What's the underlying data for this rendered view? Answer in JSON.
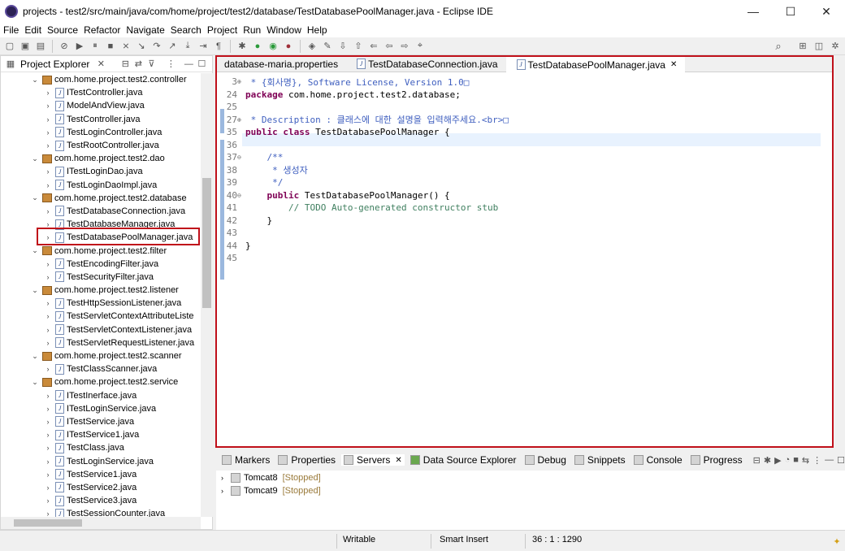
{
  "window": {
    "title": "projects - test2/src/main/java/com/home/project/test2/database/TestDatabasePoolManager.java - Eclipse IDE",
    "min": "—",
    "max": "☐",
    "close": "✕"
  },
  "menu": [
    "File",
    "Edit",
    "Source",
    "Refactor",
    "Navigate",
    "Search",
    "Project",
    "Run",
    "Window",
    "Help"
  ],
  "project_explorer": {
    "title": "Project Explorer",
    "tree": [
      {
        "kind": "pkg",
        "label": "com.home.project.test2.controller"
      },
      {
        "kind": "file",
        "label": "ITestController.java"
      },
      {
        "kind": "file",
        "label": "ModelAndView.java"
      },
      {
        "kind": "file",
        "label": "TestController.java"
      },
      {
        "kind": "file",
        "label": "TestLoginController.java"
      },
      {
        "kind": "file",
        "label": "TestRootController.java"
      },
      {
        "kind": "pkg",
        "label": "com.home.project.test2.dao"
      },
      {
        "kind": "file",
        "label": "ITestLoginDao.java"
      },
      {
        "kind": "file",
        "label": "TestLoginDaoImpl.java"
      },
      {
        "kind": "pkg",
        "label": "com.home.project.test2.database"
      },
      {
        "kind": "file",
        "label": "TestDatabaseConnection.java"
      },
      {
        "kind": "file",
        "label": "TestDatabaseManager.java"
      },
      {
        "kind": "file",
        "label": "TestDatabasePoolManager.java"
      },
      {
        "kind": "pkg",
        "label": "com.home.project.test2.filter"
      },
      {
        "kind": "file",
        "label": "TestEncodingFilter.java"
      },
      {
        "kind": "file",
        "label": "TestSecurityFilter.java"
      },
      {
        "kind": "pkg",
        "label": "com.home.project.test2.listener"
      },
      {
        "kind": "file",
        "label": "TestHttpSessionListener.java"
      },
      {
        "kind": "file",
        "label": "TestServletContextAttributeListe"
      },
      {
        "kind": "file",
        "label": "TestServletContextListener.java"
      },
      {
        "kind": "file",
        "label": "TestServletRequestListener.java"
      },
      {
        "kind": "pkg",
        "label": "com.home.project.test2.scanner"
      },
      {
        "kind": "file",
        "label": "TestClassScanner.java"
      },
      {
        "kind": "pkg",
        "label": "com.home.project.test2.service"
      },
      {
        "kind": "file",
        "label": "ITestInerface.java"
      },
      {
        "kind": "file",
        "label": "ITestLoginService.java"
      },
      {
        "kind": "file",
        "label": "ITestService.java"
      },
      {
        "kind": "file",
        "label": "ITestService1.java"
      },
      {
        "kind": "file",
        "label": "TestClass.java"
      },
      {
        "kind": "file",
        "label": "TestLoginService.java"
      },
      {
        "kind": "file",
        "label": "TestService1.java"
      },
      {
        "kind": "file",
        "label": "TestService2.java"
      },
      {
        "kind": "file",
        "label": "TestService3.java"
      },
      {
        "kind": "file",
        "label": "TestSessionCounter.java"
      }
    ]
  },
  "editor": {
    "tabs": [
      "database-maria.properties",
      "TestDatabaseConnection.java",
      "TestDatabasePoolManager.java"
    ],
    "active_tab": "TestDatabasePoolManager.java",
    "lines": [
      {
        "n": "3",
        "fold": "⊕",
        "parts": [
          [
            "cm",
            " * {회사명}, Software License, Version 1.0□"
          ]
        ]
      },
      {
        "n": "24",
        "fold": "",
        "parts": [
          [
            "kw",
            "package"
          ],
          [
            "",
            " com.home.project.test2.database;"
          ]
        ]
      },
      {
        "n": "25",
        "fold": "",
        "parts": []
      },
      {
        "n": "27",
        "fold": "⊕",
        "parts": [
          [
            "cm",
            " * Description : 클래스에 대한 설명을 입력해주세요.<br>□"
          ]
        ]
      },
      {
        "n": "35",
        "fold": "",
        "parts": [
          [
            "kw",
            "public class"
          ],
          [
            "",
            " TestDatabasePoolManager {"
          ]
        ]
      },
      {
        "n": "36",
        "fold": "",
        "parts": []
      },
      {
        "n": "37",
        "fold": "⊖",
        "parts": [
          [
            "cm",
            "    /**"
          ]
        ]
      },
      {
        "n": "38",
        "fold": "",
        "parts": [
          [
            "cm",
            "     * 생성자"
          ]
        ]
      },
      {
        "n": "39",
        "fold": "",
        "parts": [
          [
            "cm",
            "     */"
          ]
        ]
      },
      {
        "n": "40",
        "fold": "⊖",
        "parts": [
          [
            "",
            "    "
          ],
          [
            "kw",
            "public"
          ],
          [
            "",
            " TestDatabasePoolManager() {"
          ]
        ]
      },
      {
        "n": "41",
        "fold": "",
        "parts": [
          [
            "cmt",
            "        // TODO Auto-generated constructor stub"
          ]
        ]
      },
      {
        "n": "42",
        "fold": "",
        "parts": [
          [
            "",
            "    }"
          ]
        ]
      },
      {
        "n": "43",
        "fold": "",
        "parts": []
      },
      {
        "n": "44",
        "fold": "",
        "parts": [
          [
            "",
            "}"
          ]
        ]
      },
      {
        "n": "45",
        "fold": "",
        "parts": []
      }
    ]
  },
  "bottom_panel": {
    "tabs": [
      "Markers",
      "Properties",
      "Servers",
      "Data Source Explorer",
      "Debug",
      "Snippets",
      "Console",
      "Progress"
    ],
    "servers": [
      {
        "name": "Tomcat8",
        "state": "[Stopped]"
      },
      {
        "name": "Tomcat9",
        "state": "[Stopped]"
      }
    ]
  },
  "status_bar": {
    "mode": "Writable",
    "insert": "Smart Insert",
    "position": "36 : 1 : 1290"
  }
}
